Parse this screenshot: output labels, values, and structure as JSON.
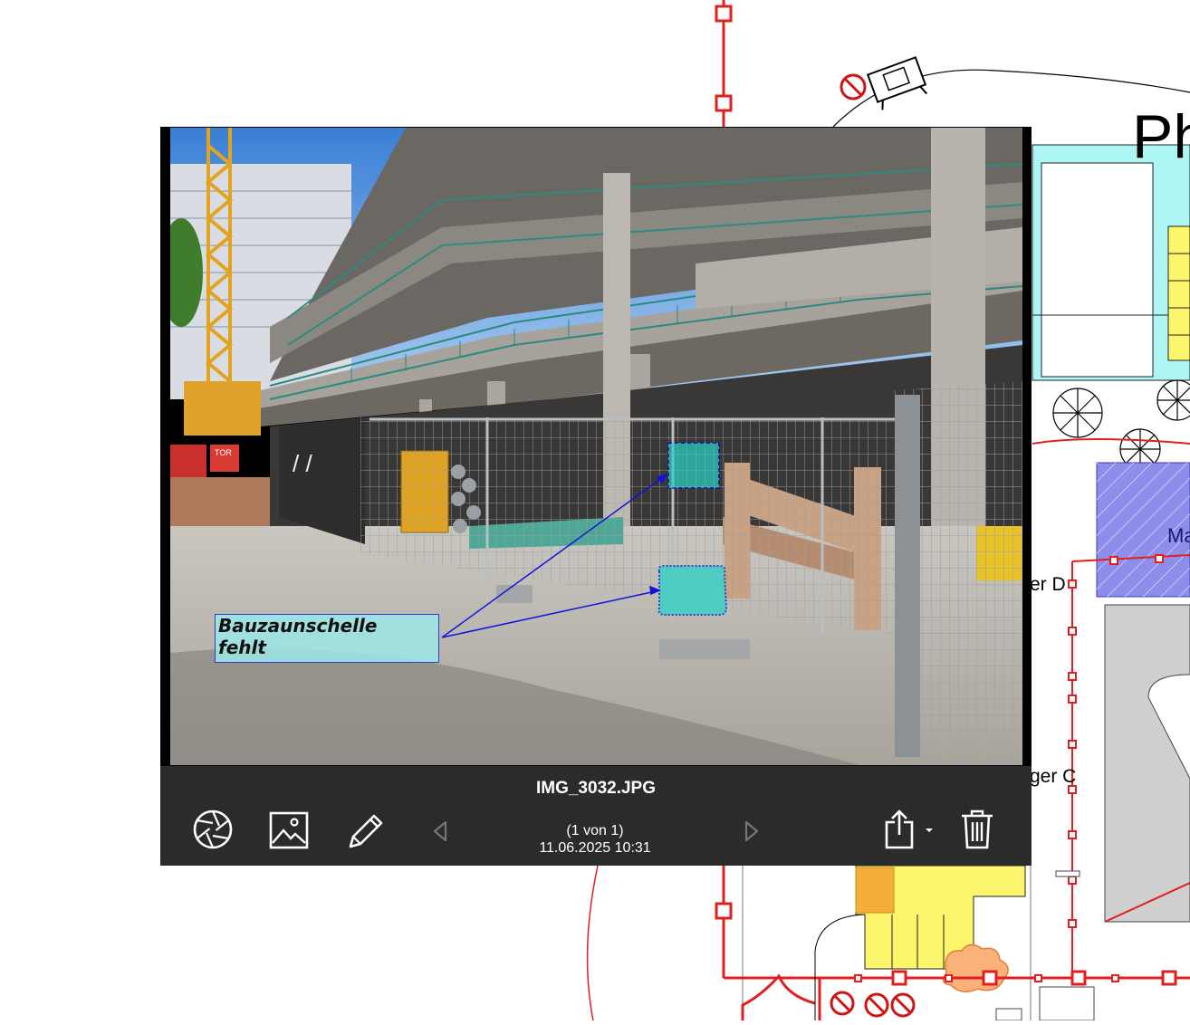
{
  "plan": {
    "title_fragment": "Ph",
    "room_label_fragment": "Ma",
    "lager_d_fragment": "er D",
    "lager_c_fragment": "ger C"
  },
  "viewer": {
    "filename": "IMG_3032.JPG",
    "counter": "(1 von 1)",
    "datetime": "11.06.2025 10:31",
    "annotation_text": "Bauzaunschelle fehlt",
    "annotation_line1": "Bauzaunschelle",
    "annotation_line2": "fehlt",
    "photo_signs": {
      "tor": "TOR"
    }
  },
  "toolbar": {
    "icons": {
      "camera": "aperture-icon",
      "gallery": "image-icon",
      "edit": "pencil-icon",
      "prev": "chevron-left-icon",
      "next": "chevron-right-icon",
      "share": "share-icon",
      "delete": "trash-icon"
    }
  },
  "colors": {
    "plan_red": "#e11f1f",
    "plan_cyan": "#aef6f6",
    "plan_yellow": "#fbf66b",
    "plan_blue_room": "#8d8dea",
    "plan_gray": "#cfcfcf",
    "toolbar_bg": "#2b2b2b",
    "annotation_fill": "#9be7e7",
    "annotation_border": "#3a3ad0"
  }
}
